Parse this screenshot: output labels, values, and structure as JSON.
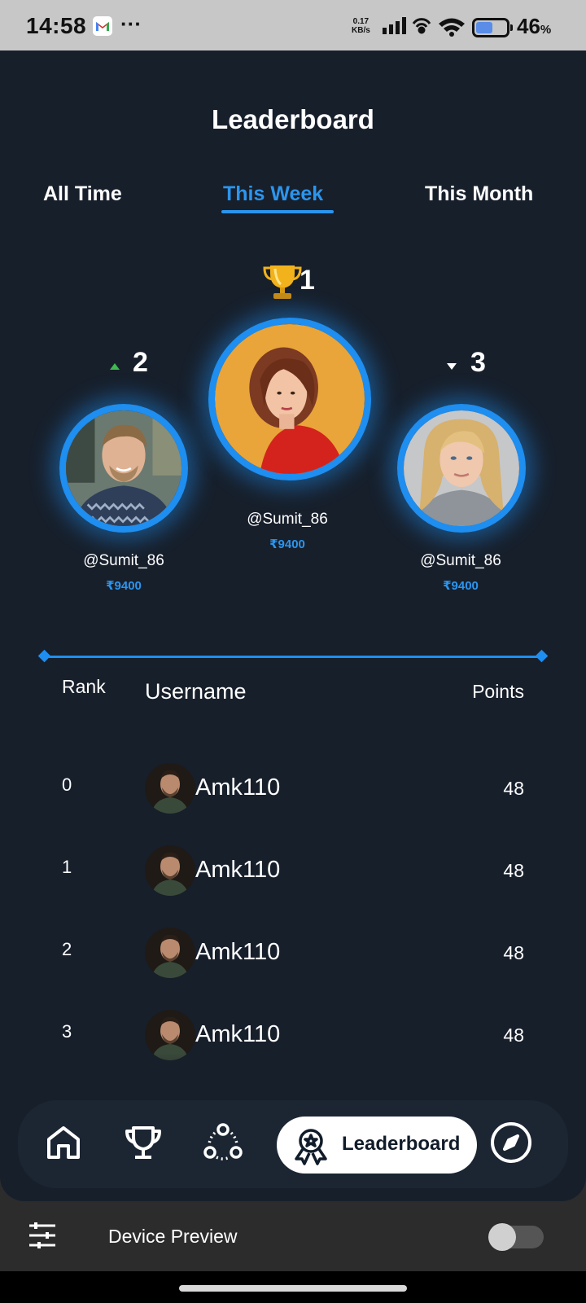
{
  "status_bar": {
    "time": "14:58",
    "net_speed_value": "0.17",
    "net_speed_unit": "KB/s",
    "battery_percent": "46",
    "battery_unit": "%",
    "icons": [
      "gmail-icon",
      "more-dots-icon",
      "signal-icon",
      "hotspot-icon",
      "wifi-icon",
      "battery-icon"
    ]
  },
  "header": {
    "title": "Leaderboard"
  },
  "tabs": [
    {
      "label": "All Time",
      "active": false
    },
    {
      "label": "This Week",
      "active": true
    },
    {
      "label": "This Month",
      "active": false
    }
  ],
  "podium": {
    "first": {
      "rank": "1",
      "username": "@Sumit_86",
      "amount": "₹9400",
      "icon": "trophy-icon"
    },
    "second": {
      "rank": "2",
      "username": "@Sumit_86",
      "amount": "₹9400",
      "trend": "up"
    },
    "third": {
      "rank": "3",
      "username": "@Sumit_86",
      "amount": "₹9400",
      "trend": "down"
    }
  },
  "table": {
    "headers": {
      "rank": "Rank",
      "username": "Username",
      "points": "Points"
    },
    "rows": [
      {
        "rank": "0",
        "username": "Amk110",
        "points": "48"
      },
      {
        "rank": "1",
        "username": "Amk110",
        "points": "48"
      },
      {
        "rank": "2",
        "username": "Amk110",
        "points": "48"
      },
      {
        "rank": "3",
        "username": "Amk110",
        "points": "48"
      }
    ]
  },
  "bottom_nav": {
    "items": [
      "home-icon",
      "trophy-icon",
      "community-icon",
      "leaderboard-icon",
      "explore-icon"
    ],
    "active_label": "Leaderboard"
  },
  "device_preview": {
    "label": "Device Preview",
    "enabled": false
  },
  "colors": {
    "background": "#171f2b",
    "accent": "#2b95ee",
    "nav_bg": "#1c2633"
  }
}
